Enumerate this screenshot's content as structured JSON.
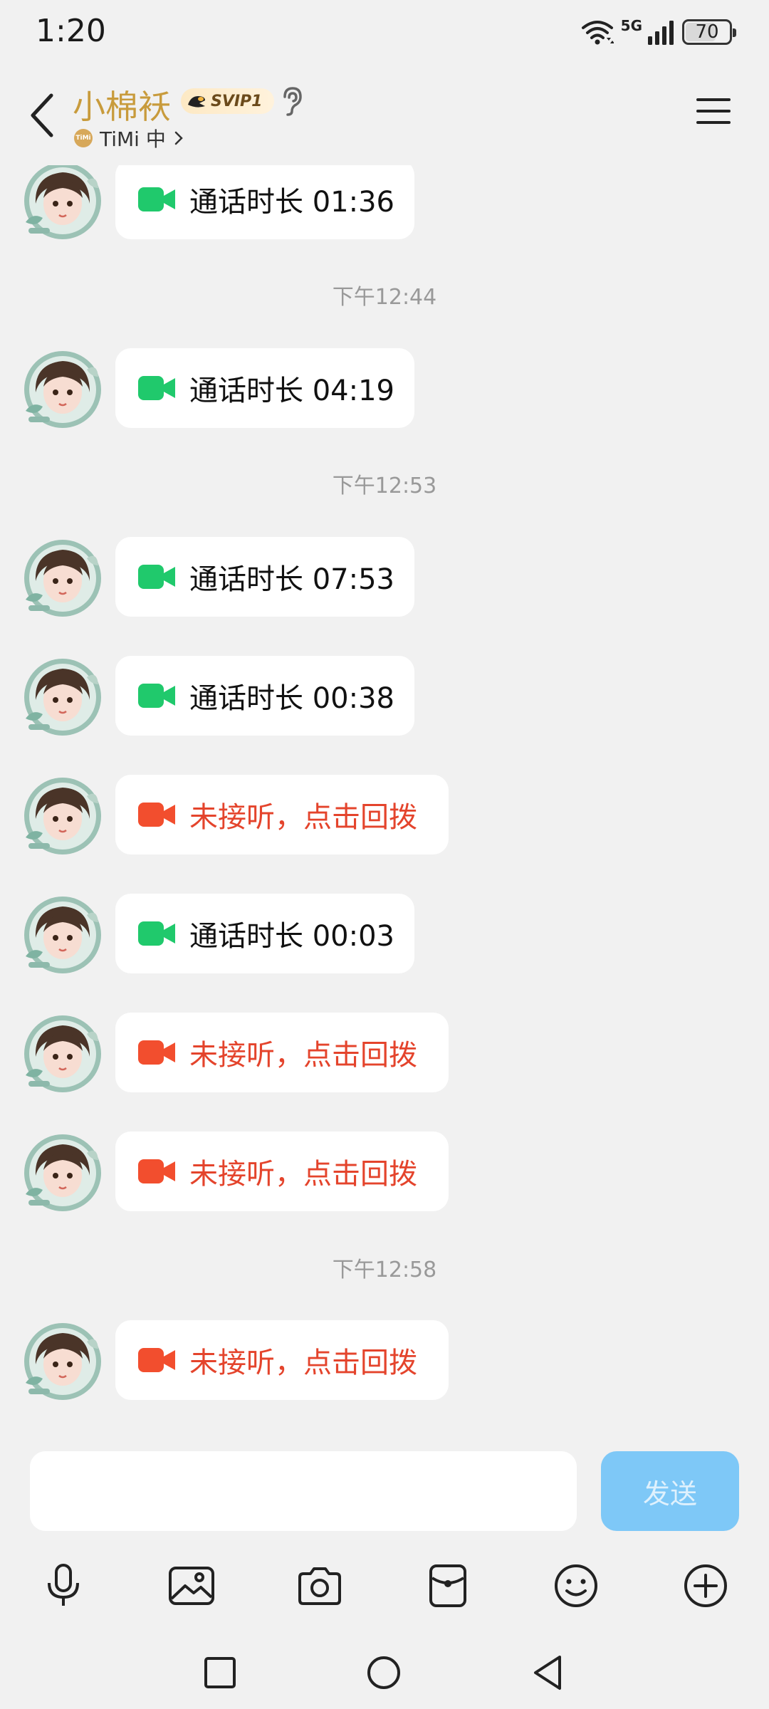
{
  "status_bar": {
    "time": "1:20",
    "network": "5G",
    "battery": "70",
    "battery_level_percent": 70
  },
  "header": {
    "contact_name": "小棉袄",
    "vip_badge": "SVIP1",
    "status_text": "TiMi 中",
    "timi_logo": "TiMi"
  },
  "messages": [
    {
      "kind": "call",
      "status": "ok",
      "text": "通话时长 01:36"
    },
    {
      "kind": "time",
      "text": "下午12:44"
    },
    {
      "kind": "call",
      "status": "ok",
      "text": "通话时长 04:19"
    },
    {
      "kind": "time",
      "text": "下午12:53"
    },
    {
      "kind": "call",
      "status": "ok",
      "text": "通话时长 07:53"
    },
    {
      "kind": "call",
      "status": "ok",
      "text": "通话时长 00:38"
    },
    {
      "kind": "call",
      "status": "missed",
      "text": "未接听，点击回拨"
    },
    {
      "kind": "call",
      "status": "ok",
      "text": "通话时长 00:03"
    },
    {
      "kind": "call",
      "status": "missed",
      "text": "未接听，点击回拨"
    },
    {
      "kind": "call",
      "status": "missed",
      "text": "未接听，点击回拨"
    },
    {
      "kind": "time",
      "text": "下午12:58"
    },
    {
      "kind": "call",
      "status": "missed",
      "text": "未接听，点击回拨"
    }
  ],
  "input": {
    "value": "",
    "placeholder": "",
    "send_label": "发送"
  },
  "toolbar_icons": [
    "microphone-icon",
    "image-icon",
    "camera-icon",
    "red-packet-icon",
    "emoji-icon",
    "plus-icon"
  ],
  "nav_icons": [
    "recents-square-icon",
    "home-circle-icon",
    "back-triangle-icon"
  ],
  "colors": {
    "ok_call": "#20c96c",
    "missed_call": "#f24e2e",
    "name_gold": "#c89b3c",
    "send_button": "#7ec8f7"
  }
}
